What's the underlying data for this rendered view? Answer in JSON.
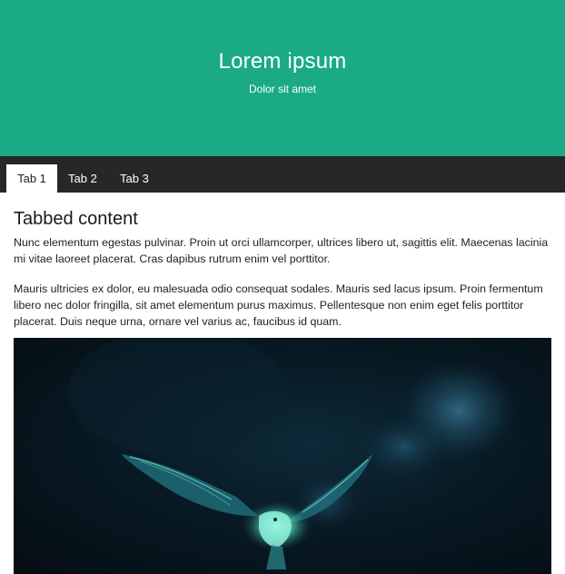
{
  "header": {
    "title": "Lorem ipsum",
    "subtitle": "Dolor sit amet"
  },
  "tabs": [
    {
      "label": "Tab 1",
      "active": true
    },
    {
      "label": "Tab 2",
      "active": false
    },
    {
      "label": "Tab 3",
      "active": false
    }
  ],
  "content": {
    "heading": "Tabbed content",
    "paragraphs": [
      "Nunc elementum egestas pulvinar. Proin ut orci ullamcorper, ultrices libero ut, sagittis elit. Maecenas lacinia mi vitae laoreet placerat. Cras dapibus rutrum enim vel porttitor.",
      "Mauris ultricies ex dolor, eu malesuada odio consequat sodales. Mauris sed lacus ipsum. Proin fermentum libero nec dolor fringilla, sit amet elementum purus maximus. Pellentesque non enim eget felis porttitor placerat. Duis neque urna, ornare vel varius ac, faucibus id quam."
    ]
  },
  "colors": {
    "hero_background": "#1aab86",
    "tabbar_background": "#272727",
    "active_tab_background": "#ffffff",
    "page_background": "#ffffff"
  }
}
